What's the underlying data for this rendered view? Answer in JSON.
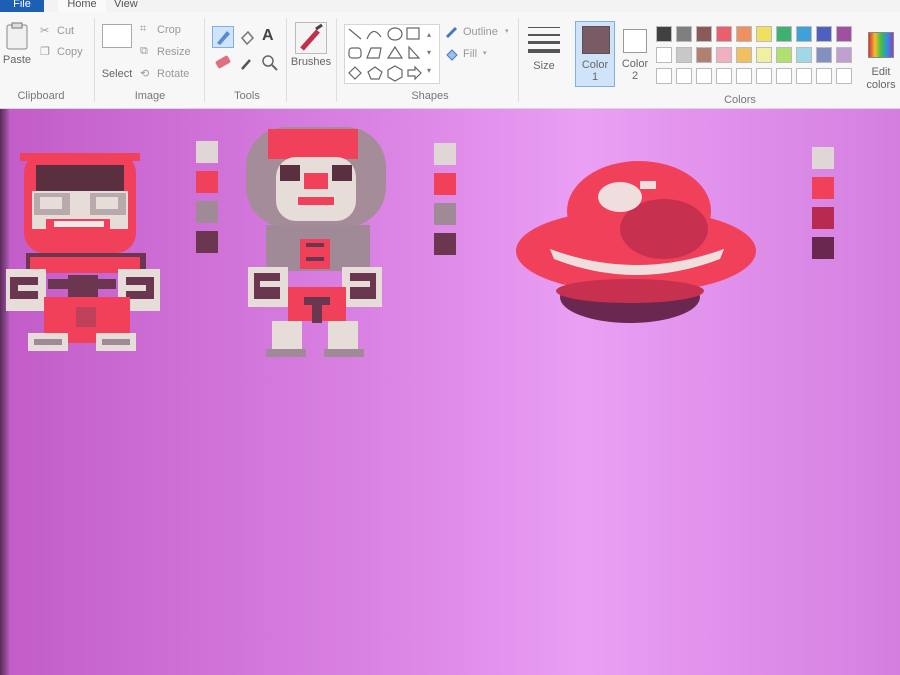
{
  "tabs": {
    "file": "File",
    "home": "Home",
    "view": "View"
  },
  "clipboard": {
    "paste": "Paste",
    "cut": "Cut",
    "copy": "Copy",
    "group": "Clipboard"
  },
  "image": {
    "select": "Select",
    "crop": "Crop",
    "resize": "Resize",
    "rotate": "Rotate",
    "group": "Image"
  },
  "tools": {
    "group": "Tools"
  },
  "brushes": {
    "label": "Brushes"
  },
  "shapes": {
    "outline": "Outline",
    "fill": "Fill",
    "group": "Shapes"
  },
  "size": {
    "label": "Size"
  },
  "color1": {
    "label": "Color",
    "num": "1",
    "color": "#7a5a64"
  },
  "color2": {
    "label": "Color",
    "num": "2",
    "color": "#ffffff"
  },
  "colors": {
    "group": "Colors",
    "edit_line1": "Edit",
    "edit_line2": "colors",
    "row1": [
      "#404040",
      "#7f7f7f",
      "#8a5a5a",
      "#e86070",
      "#f09060",
      "#f0e060",
      "#40b070",
      "#40a0d8",
      "#5060c0",
      "#a050a0"
    ],
    "row2": [
      "#ffffff",
      "#c8c8c8",
      "#b08070",
      "#f0b0c0",
      "#f0c060",
      "#f0f0a0",
      "#b0e070",
      "#a0d8e8",
      "#8090c0",
      "#c0a0d0"
    ],
    "row3": [
      "#ffffff",
      "#ffffff",
      "#ffffff",
      "#ffffff",
      "#ffffff",
      "#ffffff",
      "#ffffff",
      "#ffffff",
      "#ffffff",
      "#ffffff"
    ]
  },
  "palettes": {
    "p1": [
      "#e0d6d6",
      "#f0405a",
      "#a08a98",
      "#6a3650"
    ],
    "p2": [
      "#e0d6d6",
      "#f0405a",
      "#a08a98",
      "#6a3650"
    ],
    "p3": [
      "#e0d6d6",
      "#f0405a",
      "#b82a50",
      "#6a2850"
    ]
  }
}
